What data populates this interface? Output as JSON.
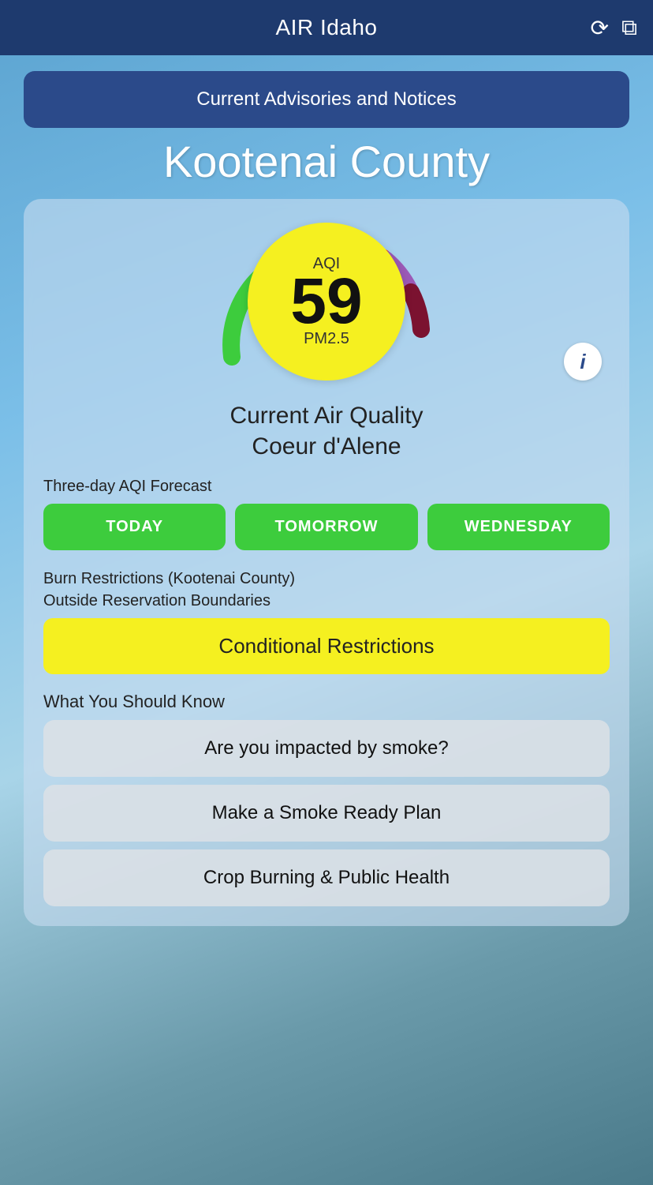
{
  "header": {
    "title": "AIR Idaho",
    "refresh_icon": "↻",
    "share_icon": "↗"
  },
  "advisories_button": {
    "label": "Current Advisories and Notices"
  },
  "county": {
    "name": "Kootenai County"
  },
  "aqi": {
    "label_top": "AQI",
    "value": "59",
    "label_bottom": "PM2.5"
  },
  "air_quality": {
    "title_line1": "Current Air Quality",
    "title_line2": "Coeur d'Alene"
  },
  "forecast": {
    "section_label": "Three-day AQI Forecast",
    "buttons": [
      {
        "label": "TODAY"
      },
      {
        "label": "TOMORROW"
      },
      {
        "label": "WEDNESDAY"
      }
    ]
  },
  "burn_restrictions": {
    "label_line1": "Burn Restrictions (Kootenai County)",
    "label_line2": "Outside Reservation Boundaries",
    "status": "Conditional Restrictions"
  },
  "know_section": {
    "label": "What You Should Know",
    "items": [
      {
        "label": "Are you impacted by smoke?"
      },
      {
        "label": "Make a Smoke Ready Plan"
      },
      {
        "label": "Crop Burning & Public Health"
      }
    ]
  },
  "gauge": {
    "colors": {
      "green": "#3dcc3d",
      "yellow": "#f5f020",
      "orange": "#f5a623",
      "red": "#e8241e",
      "purple": "#9b59b6",
      "maroon": "#7b1230"
    }
  }
}
